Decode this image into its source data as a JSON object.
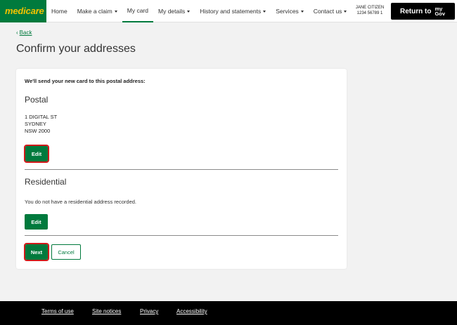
{
  "header": {
    "logo": "medicare",
    "nav": [
      {
        "label": "Home",
        "dropdown": false
      },
      {
        "label": "Make a claim",
        "dropdown": true
      },
      {
        "label": "My card",
        "dropdown": false,
        "active": true
      },
      {
        "label": "My details",
        "dropdown": true
      },
      {
        "label": "History and statements",
        "dropdown": true
      },
      {
        "label": "Services",
        "dropdown": true
      },
      {
        "label": "Contact us",
        "dropdown": true
      }
    ],
    "user_name": "JANE CITIZEN",
    "user_number": "1234 56789 1",
    "return_label": "Return to",
    "mygov_top": "my",
    "mygov_bottom": "Gov"
  },
  "back_label": "Back",
  "page_title": "Confirm your addresses",
  "card": {
    "intro": "We'll send your new card to this postal address:",
    "postal": {
      "title": "Postal",
      "lines": [
        "1 DIGITAL ST",
        "SYDNEY",
        "NSW 2000"
      ],
      "edit_label": "Edit"
    },
    "residential": {
      "title": "Residential",
      "note": "You do not have a residential address recorded.",
      "edit_label": "Edit"
    },
    "next_label": "Next",
    "cancel_label": "Cancel"
  },
  "footer": {
    "links": [
      "Terms of use",
      "Site notices",
      "Privacy",
      "Accessibility"
    ]
  },
  "colors": {
    "brand_green": "#007a3d",
    "logo_yellow": "#f3c300",
    "highlight_red": "#d11a1a",
    "footer_bg": "#000000"
  }
}
